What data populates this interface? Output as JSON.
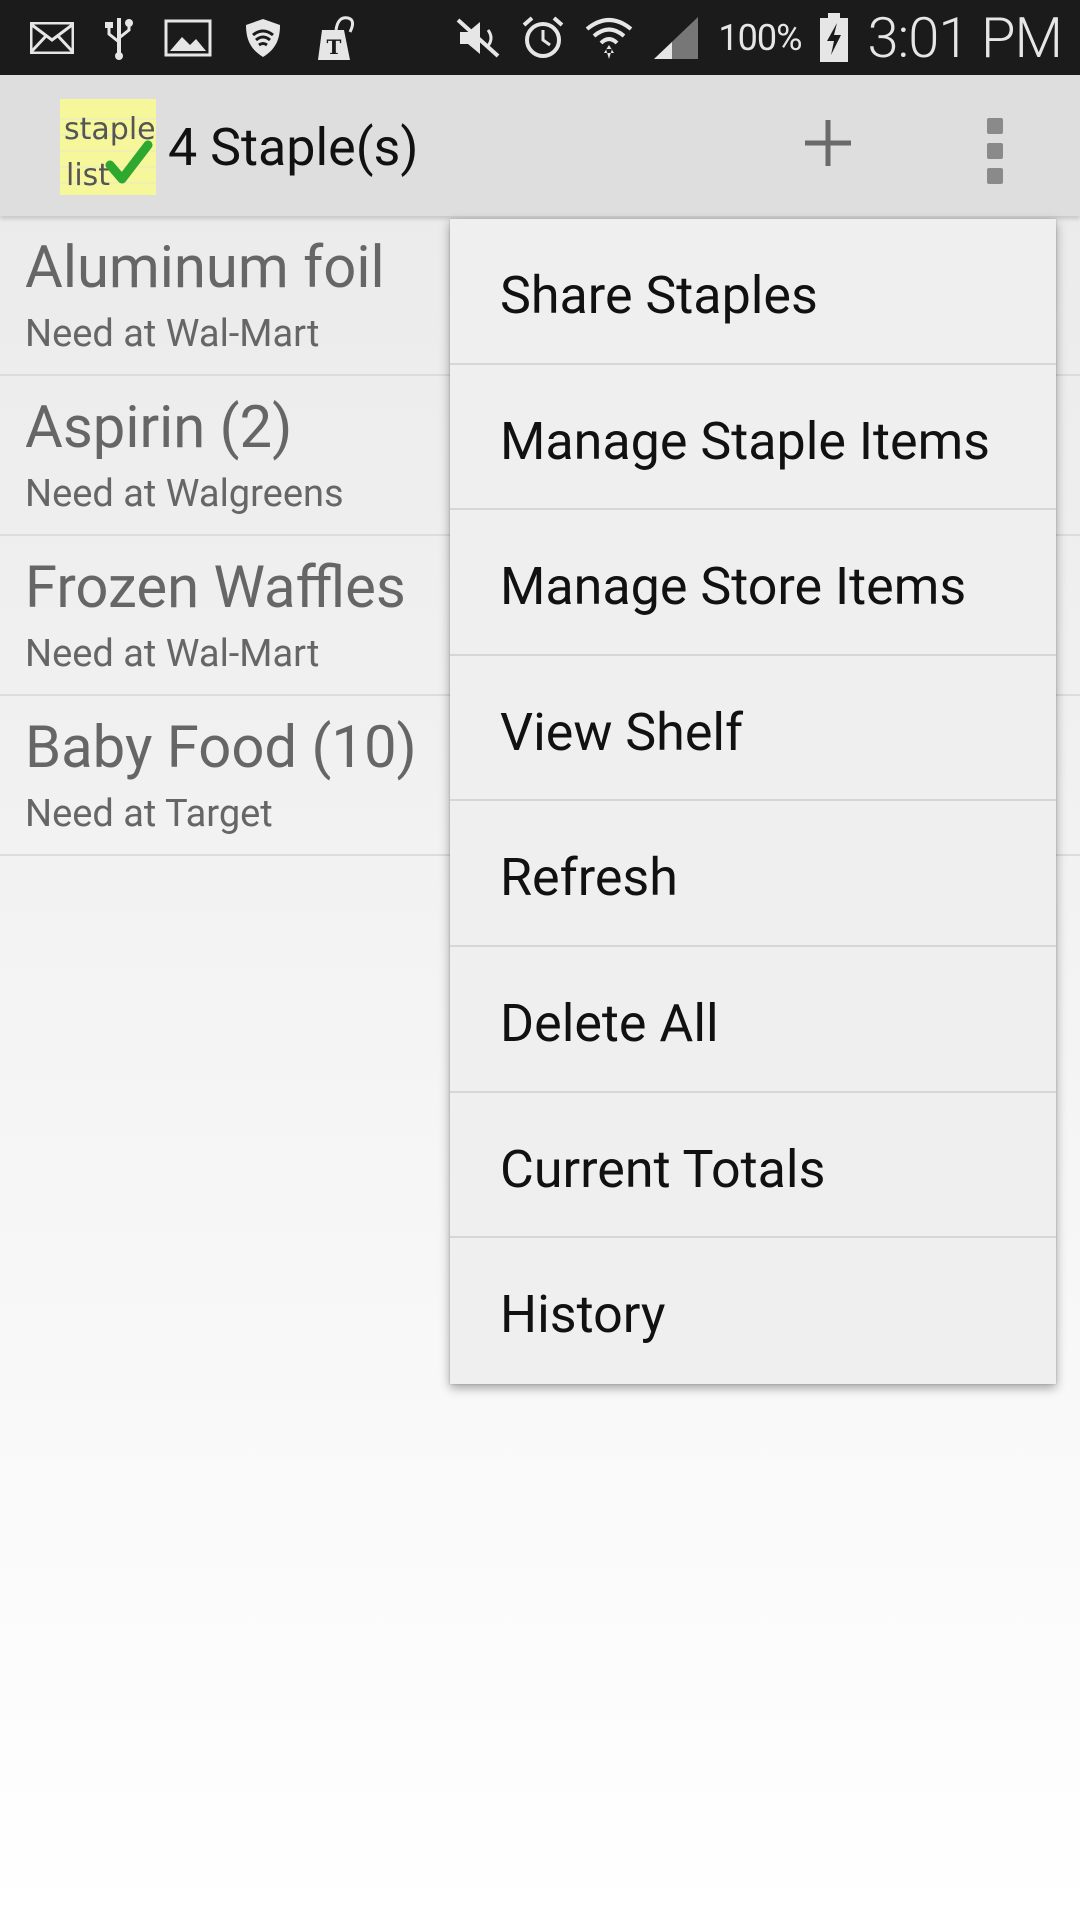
{
  "status_bar": {
    "battery_percent": "100%",
    "time": "3:01 PM",
    "icons": [
      "mail-icon",
      "usb-icon",
      "image-icon",
      "wifi-shield-icon",
      "tmobile-app-icon",
      "mute-icon",
      "alarm-icon",
      "wifi-icon",
      "signal-icon",
      "battery-charging-icon"
    ]
  },
  "action_bar": {
    "title": "4 Staple(s)",
    "logo_text_line1": "staple",
    "logo_text_line2": "list",
    "add_icon": "plus-icon",
    "overflow_icon": "overflow-menu-icon"
  },
  "staples": [
    {
      "name": "Aluminum foil",
      "detail": "Need at Wal-Mart"
    },
    {
      "name": "Aspirin (2)",
      "detail": "Need at Walgreens"
    },
    {
      "name": "Frozen Waffles",
      "detail": "Need at Wal-Mart"
    },
    {
      "name": "Baby Food (10)",
      "detail": "Need at Target"
    }
  ],
  "menu": {
    "items": [
      "Share Staples",
      "Manage Staple Items",
      "Manage Store Items",
      "View Shelf",
      "Refresh",
      "Delete All",
      "Current Totals",
      "History"
    ]
  },
  "colors": {
    "status_bar_bg": "#1b1b1b",
    "action_bar_bg": "#dedede",
    "menu_bg": "#efefef",
    "logo_bg": "#f6f79a",
    "check_green": "#2ea82e"
  }
}
